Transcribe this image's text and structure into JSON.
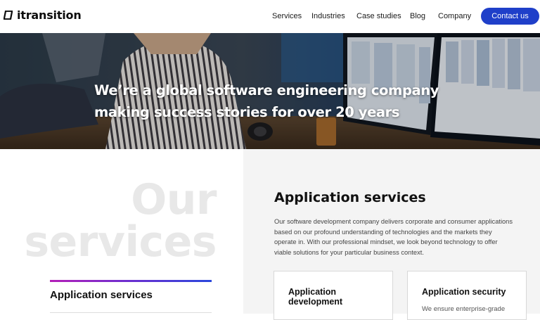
{
  "header": {
    "brand": "itransition",
    "nav": [
      "Services",
      "Industries",
      "Case studies",
      "Blog",
      "Company"
    ],
    "cta": "Contact us"
  },
  "hero": {
    "line1": "We’re a global software engineering company",
    "line2": "making success stories for over 20 years"
  },
  "services": {
    "heading_line1": "Our",
    "heading_line2": "services",
    "active_item": "Application services",
    "section_title": "Application services",
    "section_desc": "Our software development company delivers corporate and consumer applications based on our profound understanding of technologies and the markets they operate in. With our professional mindset, we look beyond technology to offer viable solutions for your particular business context.",
    "cards": [
      {
        "title": "Application development",
        "text": ""
      },
      {
        "title": "Application security",
        "text": "We ensure enterprise-grade"
      }
    ]
  },
  "colors": {
    "accent": "#1f3fc9",
    "gradient_start": "#b420b8",
    "gradient_end": "#2a47dc",
    "right_panel_bg": "#f4f4f4"
  }
}
